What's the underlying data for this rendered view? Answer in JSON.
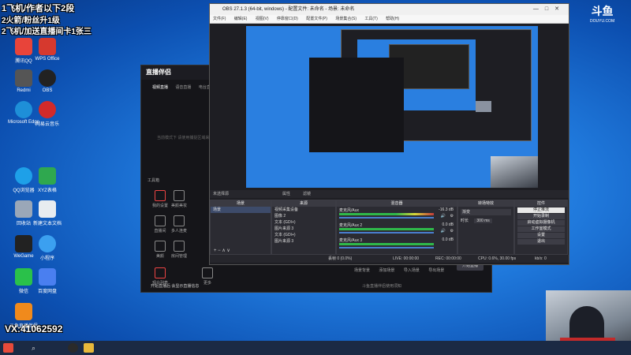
{
  "overlay": {
    "line1": "1飞机/作者以下2段",
    "line2": "2火箭/粉丝升1级",
    "line3": "2飞机/加送直播间卡1张三",
    "line4": "VX:41062592"
  },
  "desktop_icons": [
    {
      "label": "腾讯QQ",
      "color": "#e8443a"
    },
    {
      "label": "WPS Office",
      "color": "#d6392e"
    },
    {
      "label": "Redmi",
      "color": "#555555"
    },
    {
      "label": "OBS",
      "color": "#222222"
    },
    {
      "label": "Microsoft Edge",
      "color": "#1e8fd8"
    },
    {
      "label": "网易云音乐",
      "color": "#d22a2a"
    },
    {
      "label": "QQ浏览器",
      "color": "#1ea0e8"
    },
    {
      "label": "XYZ表格",
      "color": "#2fa84f"
    },
    {
      "label": "回收站",
      "color": "#9aa7b8"
    },
    {
      "label": "新建文本文档",
      "color": "#e8ecf0"
    },
    {
      "label": "WeGame",
      "color": "#222222"
    },
    {
      "label": "小程序",
      "color": "#3ba0f0"
    },
    {
      "label": "微信",
      "color": "#2ac14a"
    },
    {
      "label": "百度网盘",
      "color": "#4a7ff0"
    },
    {
      "label": "斗鱼直播伴侣",
      "color": "#f08a1c"
    }
  ],
  "douyu": {
    "name": "斗鱼",
    "domain": "DOUYU.COM"
  },
  "obs": {
    "title": "OBS 27.1.3 (64-bit, windows) - 配置文件: 未命名 - 场景: 未命名",
    "menu": [
      "文件(F)",
      "编辑(E)",
      "视图(V)",
      "停靠窗口(D)",
      "配置文件(P)",
      "场景集合(S)",
      "工具(T)",
      "帮助(H)"
    ],
    "no_source": "未选择源",
    "props": "属性",
    "filters": "滤镜",
    "scenes_head": "场景",
    "scene_item": "场景",
    "sources_head": "来源",
    "sources": [
      "视频采集设备",
      "图像 2",
      "文本 (GDI+)",
      "图片来源 3",
      "文本 (GDI+)",
      "图片来源 3"
    ],
    "mixer_head": "混音器",
    "mixer_rows": [
      {
        "name": "麦克风/Aux",
        "db": "-16.3 dB"
      },
      {
        "name": "麦克风/Aux 2",
        "db": "0.0 dB"
      },
      {
        "name": "麦克风/Aux 3",
        "db": "0.0 dB"
      }
    ],
    "transitions_head": "转场特效",
    "transition_type": "渐变",
    "duration_label": "时长",
    "duration_value": "300 ms",
    "controls_head": "控件",
    "controls": [
      "停止推流",
      "开始录制",
      "启动虚拟摄像机",
      "工作室模式",
      "设置",
      "退出"
    ],
    "status": {
      "drop": "丢帧 0 (0.0%)",
      "live": "LIVE: 00:00:00",
      "rec": "REC: 00:00:00",
      "cpu": "CPU: 0.6%, 30.00 fps",
      "kbps": "kb/s: 0"
    }
  },
  "zbbl": {
    "logo": "直播伴侣",
    "tabs": [
      "视频直播",
      "语音直播",
      "电台直播"
    ],
    "hint": "当前模式下 请使用捕捉区域来添加内容",
    "tools_head": "工具箱",
    "tools": [
      "我的设置",
      "美颜美妆",
      "直播间",
      "多人连麦",
      "美颜",
      "房间管理",
      "观众列表",
      "更多"
    ],
    "bottom_actions": [
      "场景背景",
      "添加场景",
      "导入场景",
      "导出场景",
      "开始直播"
    ],
    "bottom_hint": "斗鱼直播伴侣使用须知",
    "footer": "开始直播后 会显示直播信息"
  },
  "taskbar": {
    "start_icon": "windows-logo",
    "search_icon": "search-icon",
    "apps": [
      "obs",
      "explorer",
      "douyu"
    ]
  }
}
